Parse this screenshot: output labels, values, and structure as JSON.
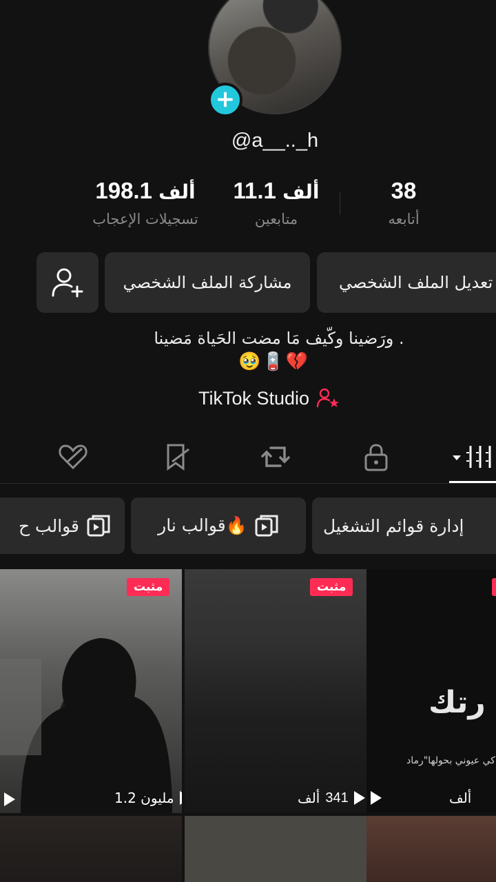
{
  "profile": {
    "username": "@a__.._h",
    "stats": {
      "following": {
        "num": "38",
        "label": "أتابعه"
      },
      "followers": {
        "num": "11.1",
        "unit": "ألف",
        "label": "متابعين"
      },
      "likes": {
        "num": "198.1",
        "unit": "ألف",
        "label": "تسجيلات الإعجاب"
      }
    },
    "buttons": {
      "edit": "تعديل الملف الشخصي",
      "share": "مشاركة الملف الشخصي"
    },
    "bio_line1": "ورَضينا وكّيف مَا مضت الحَياة مَضينا .",
    "bio_emojis": "🥹🪫💔",
    "studio_label": "TikTok Studio"
  },
  "tabs": [
    "videos-grid",
    "private",
    "reposts",
    "favorites",
    "liked"
  ],
  "chips": {
    "playlists": "إدارة قوائم التشغيل",
    "templates_fire": "قوالب نار🔥",
    "templates_partial": "قوالب ح"
  },
  "videos": [
    {
      "pinned": "مثبت",
      "views": ""
    },
    {
      "pinned": "مثبت",
      "views": "341",
      "unit": "ألف"
    },
    {
      "pinned": "مثبت",
      "views": "1.2 مليون"
    }
  ],
  "tile_text": {
    "big": "رتك",
    "small": "كي عيوني بحولها\"رماد\""
  },
  "colors": {
    "accent": "#fe2c55",
    "plus": "#22c7dc",
    "bg": "#121212",
    "button": "#2a2a2a"
  }
}
